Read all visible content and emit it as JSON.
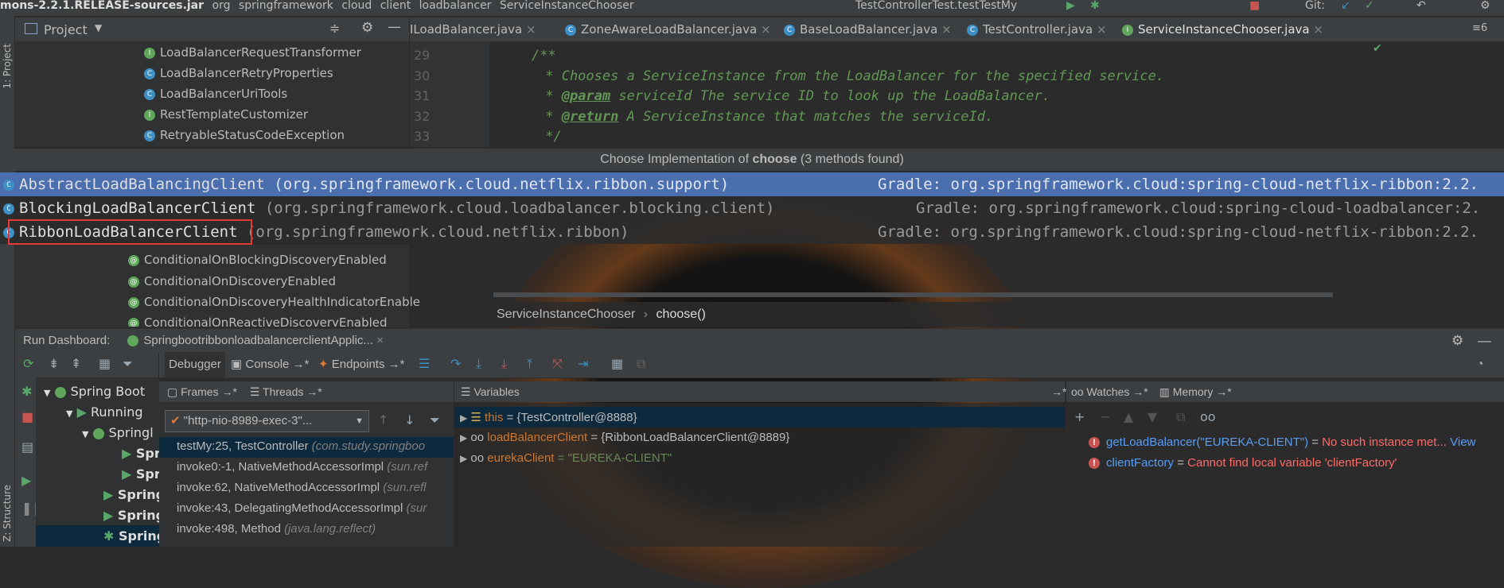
{
  "breadcrumb": {
    "items": [
      "mons-2.2.1.RELEASE-sources.jar",
      "org",
      "springframework",
      "cloud",
      "client",
      "loadbalancer",
      "ServiceInstanceChooser"
    ],
    "run_config": "TestControllerTest.testTestMy",
    "git_label": "Git:"
  },
  "project_panel": {
    "side_label": "1: Project",
    "title": "Project",
    "items": [
      "LoadBalancerRequestTransformer",
      "LoadBalancerRetryProperties",
      "LoadBalancerUriTools",
      "RestTemplateCustomizer",
      "RetryableStatusCodeException"
    ]
  },
  "editor": {
    "tabs": [
      "ILoadBalancer.java",
      "ZoneAwareLoadBalancer.java",
      "BaseLoadBalancer.java",
      "TestController.java",
      "ServiceInstanceChooser.java"
    ],
    "tab_overflow": "≡6",
    "lines": [
      {
        "num": "29",
        "text": "/**"
      },
      {
        "num": "30",
        "text": " * Chooses a ServiceInstance from the LoadBalancer for the specified service."
      },
      {
        "num": "31",
        "tag": "@param",
        "text": " serviceId The service ID to look up the LoadBalancer."
      },
      {
        "num": "32",
        "tag": "@return",
        "text": " A ServiceInstance that matches the serviceId."
      },
      {
        "num": "33",
        "text": " */"
      }
    ]
  },
  "popup": {
    "title_prefix": "Choose Implementation of ",
    "title_method": "choose",
    "title_suffix": " (3 methods found)",
    "rows": [
      {
        "name": "AbstractLoadBalancingClient",
        "package": " (org.springframework.cloud.netflix.ribbon.support)",
        "source": "Gradle: org.springframework.cloud:spring-cloud-netflix-ribbon:2.2."
      },
      {
        "name": "BlockingLoadBalancerClient",
        "package": " (org.springframework.cloud.loadbalancer.blocking.client)",
        "source": "Gradle: org.springframework.cloud:spring-cloud-loadbalancer:2."
      },
      {
        "name": "RibbonLoadBalancerClient",
        "package": " (org.springframework.cloud.netflix.ribbon)",
        "source": "Gradle: org.springframework.cloud:spring-cloud-netflix-ribbon:2.2."
      }
    ]
  },
  "tree2": {
    "items": [
      "ConditionalOnBlockingDiscoveryEnabled",
      "ConditionalOnDiscoveryEnabled",
      "ConditionalOnDiscoveryHealthIndicatorEnable",
      "ConditionalOnReactiveDiscoveryEnabled"
    ]
  },
  "editor_crumbs": {
    "class": "ServiceInstanceChooser",
    "method": "choose()"
  },
  "run_dashboard": {
    "label": "Run Dashboard:",
    "app_tab": "SpringbootribbonloadbalancerclientApplic...",
    "debug_tabs": {
      "debugger": "Debugger",
      "console": "Console",
      "endpoints": "Endpoints"
    },
    "tree": [
      "Spring Boot",
      "Running",
      "Springl",
      "Spri",
      "Spri",
      "Spring",
      "Spring",
      "Spring"
    ],
    "structure_label": "Z: Structure"
  },
  "frames": {
    "header": "Frames",
    "threads_header": "Threads",
    "thread_selector": "\"http-nio-8989-exec-3\"...",
    "items": [
      {
        "method": "testMy:25, TestController",
        "pkg": " (com.study.springboo"
      },
      {
        "method": "invoke0:-1, NativeMethodAccessorImpl",
        "pkg": " (sun.ref"
      },
      {
        "method": "invoke:62, NativeMethodAccessorImpl",
        "pkg": " (sun.refl"
      },
      {
        "method": "invoke:43, DelegatingMethodAccessorImpl",
        "pkg": " (sur"
      },
      {
        "method": "invoke:498, Method",
        "pkg": " (java.lang.reflect)"
      }
    ]
  },
  "variables": {
    "header": "Variables",
    "items": [
      {
        "name": "this",
        "value": " = {TestController@8888}"
      },
      {
        "name": "loadBalancerClient",
        "value": " = {RibbonLoadBalancerClient@8889}"
      },
      {
        "name": "eurekaClient",
        "value": " = \"EUREKA-CLIENT\""
      }
    ]
  },
  "watches": {
    "header": "Watches",
    "memory_header": "Memory",
    "items": [
      {
        "expr": "getLoadBalancer(\"EUREKA-CLIENT\")",
        "msg": "No such instance met...",
        "link": "View"
      },
      {
        "expr": "clientFactory",
        "msg": "Cannot find local variable 'clientFactory'",
        "link": ""
      }
    ]
  },
  "colors": {
    "selection": "#4b6eaf",
    "highlight_box": "#e53935",
    "doc_comment": "#629755",
    "error": "#ff6b68",
    "link": "#589df6",
    "string": "#6a8759"
  }
}
